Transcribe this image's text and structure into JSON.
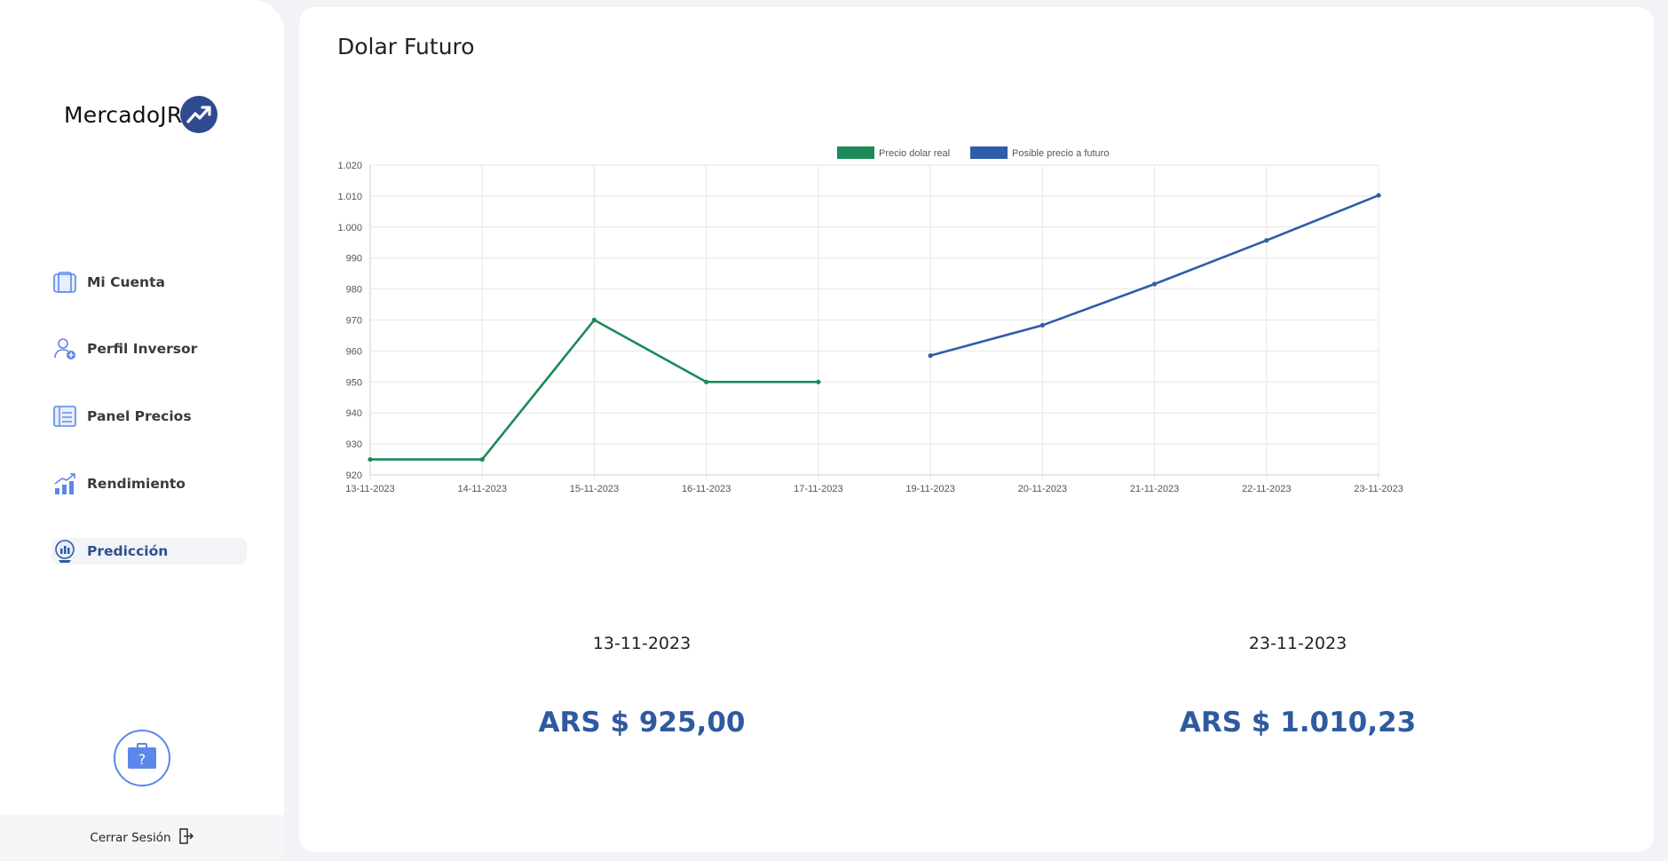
{
  "sidebar": {
    "logo_text": "MercadoJR",
    "items": [
      {
        "label": "Mi Cuenta",
        "icon": "wallet-icon"
      },
      {
        "label": "Perfil Inversor",
        "icon": "user-profile-icon"
      },
      {
        "label": "Panel Precios",
        "icon": "price-panel-icon"
      },
      {
        "label": "Rendimiento",
        "icon": "growth-chart-icon"
      },
      {
        "label": "Predicción",
        "icon": "prediction-icon",
        "active": true
      }
    ],
    "help_icon": "help-briefcase-icon",
    "logout_label": "Cerrar Sesión",
    "logout_icon": "logout-icon"
  },
  "main": {
    "title": "Dolar Futuro",
    "left_stat": {
      "date": "13-11-2023",
      "value": "ARS $ 925,00"
    },
    "right_stat": {
      "date": "23-11-2023",
      "value": "ARS $ 1.010,23"
    }
  },
  "colors": {
    "real": "#1b8a57",
    "future": "#2f5ca8",
    "accent": "#2e5aa0"
  },
  "chart_data": {
    "type": "line",
    "categories": [
      "13-11-2023",
      "14-11-2023",
      "15-11-2023",
      "16-11-2023",
      "17-11-2023",
      "19-11-2023",
      "20-11-2023",
      "21-11-2023",
      "22-11-2023",
      "23-11-2023"
    ],
    "series": [
      {
        "name": "Precio dolar real",
        "color": "#1b8a57",
        "values": [
          925,
          925,
          970,
          950,
          950,
          null,
          null,
          null,
          null,
          null
        ]
      },
      {
        "name": "Posible precio a futuro",
        "color": "#2f5ca8",
        "values": [
          null,
          null,
          null,
          null,
          null,
          958.5,
          968.3,
          981.6,
          995.7,
          1010.23
        ]
      }
    ],
    "ylim": [
      920,
      1020
    ],
    "yticks": [
      "920",
      "930",
      "940",
      "950",
      "960",
      "970",
      "980",
      "990",
      "1.000",
      "1.010",
      "1.020"
    ],
    "grid": true,
    "legend": "top-center"
  }
}
